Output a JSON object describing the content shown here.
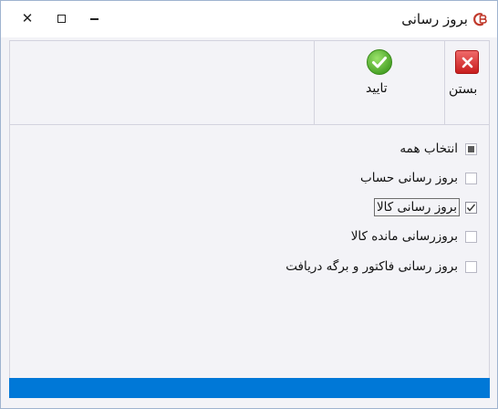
{
  "window": {
    "title": "بروز رسانی",
    "logo_icon": "gb-logo-icon"
  },
  "titlebar_controls": {
    "close_glyph": "✕",
    "close_icon": "close-icon",
    "maximize_icon": "maximize-icon",
    "minimize_icon": "minimize-icon"
  },
  "toolbar": {
    "close_label": "بستن",
    "close_icon": "close-x-icon",
    "close_color": "#d12d2d",
    "confirm_label": "تایید",
    "confirm_icon": "checkmark-icon",
    "confirm_color": "#5cb531"
  },
  "options": [
    {
      "label": "انتخاب همه",
      "state": "indeterminate"
    },
    {
      "label": "بروز رسانی حساب",
      "state": "unchecked"
    },
    {
      "label": "بروز رسانی کالا",
      "state": "checked",
      "focused": true
    },
    {
      "label": "بروزرسانی مانده کالا",
      "state": "unchecked"
    },
    {
      "label": "بروز رسانی فاکتور و برگه دریافت",
      "state": "unchecked"
    }
  ],
  "statusbar": {
    "color": "#0078d7"
  }
}
